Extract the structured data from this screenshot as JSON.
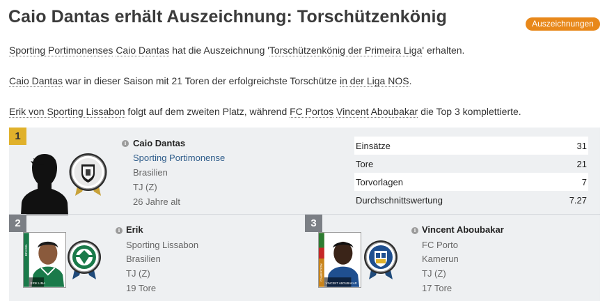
{
  "header": {
    "title": "Caio Dantas erhält Auszeichnung: Torschützenkönig",
    "awards_button": "Auszeichnungen"
  },
  "paragraphs": {
    "p1": {
      "club": "Sporting Portimonenses",
      "player": "Caio Dantas",
      "text1": " hat die Auszeichnung '",
      "award": "Torschützenkönig der Primeira Liga",
      "text2": "' erhalten."
    },
    "p2": {
      "player": "Caio Dantas",
      "text1": " war in dieser Saison mit 21 Toren der erfolgreichste Torschütze ",
      "league": "in der Liga NOS",
      "text2": "."
    },
    "p3": {
      "player": "Erik von Sporting Lissabon",
      "text1": " folgt auf dem zweiten Platz, während ",
      "club": "FC Portos",
      "player2": "Vincent Aboubakar",
      "text2": " die Top 3 komplettierte."
    }
  },
  "first": {
    "rank": "1",
    "name": "Caio Dantas",
    "club": "Sporting Portimonense",
    "nation": "Brasilien",
    "position": "TJ (Z)",
    "age": "26 Jahre alt",
    "stats": [
      {
        "label": "Einsätze",
        "value": "31"
      },
      {
        "label": "Tore",
        "value": "21"
      },
      {
        "label": "Torvorlagen",
        "value": "7"
      },
      {
        "label": "Durchschnittswertung",
        "value": "7.27"
      }
    ]
  },
  "second": {
    "rank": "2",
    "name": "Erik",
    "club": "Sporting Lissabon",
    "nation": "Brasilien",
    "position": "TJ (Z)",
    "goals": "19 Tore",
    "photo_caption": "ERIK LIMA",
    "photo_side": "BRASIL"
  },
  "third": {
    "rank": "3",
    "name": "Vincent Aboubakar",
    "club": "FC Porto",
    "nation": "Kamerun",
    "position": "TJ (Z)",
    "goals": "17 Tore",
    "photo_caption": "VINCENT ABOUBAKAR",
    "photo_side": "CAMEROON"
  },
  "colors": {
    "accent": "#e8881a",
    "gold": "#e0b12b",
    "rank_grey": "#7b7f85",
    "panel": "#eef0f2",
    "link": "#2e5c8a",
    "sporting_green": "#1a7a4a",
    "porto_blue": "#1f4f8f"
  }
}
